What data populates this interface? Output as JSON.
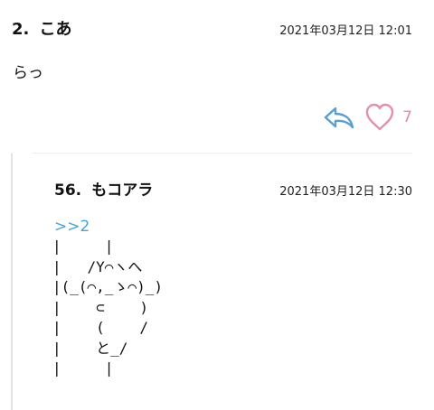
{
  "comment1": {
    "number": "2.",
    "name": "こあ",
    "date": "2021年03月12日 12:01",
    "body": "らっ",
    "like_count": "7"
  },
  "comment2": {
    "number": "56.",
    "name": "もコアラ",
    "date": "2021年03月12日 12:30",
    "anchor": ">>2",
    "art": "|     |\n|   /Y⌒ヽへ\n|(_(⌒,_ゝ⌒)_)\n|    ⊂    )\n|    (    /\n|    と_/\n|     |"
  },
  "icons": {
    "reply": "reply-arrow-icon",
    "like": "heart-icon"
  },
  "colors": {
    "reply_icon": "#5b9fd0",
    "heart_icon": "#e58fae",
    "anchor": "#4aa3d6"
  }
}
